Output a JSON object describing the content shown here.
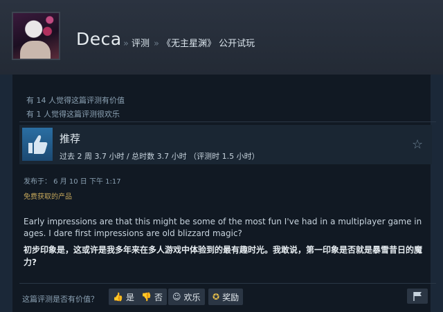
{
  "header": {
    "username": "Deca",
    "breadcrumbs": [
      "评测",
      "《无主星渊》 公开试玩"
    ],
    "separator": "»"
  },
  "helpful_stats": [
    "有 14 人觉得这篇评测有价值",
    "有 1 人觉得这篇评测很欢乐"
  ],
  "recommendation": {
    "title": "推荐",
    "hours": "过去 2 周 3.7 小时 / 总时数 3.7 小时 （评测时 1.5 小时）",
    "icon": "thumbs-up-icon"
  },
  "meta": {
    "posted": "发布于：  6 月 10 日 下午 1:17",
    "product_type": "免费获取的产品"
  },
  "review": {
    "text_en": "Early impressions are that this might be some of the most fun I've had in a multiplayer game in ages. I dare first impressions are old blizzard magic?",
    "text_zh": "初步印象是，这或许是我多年来在多人游戏中体验到的最有趣时光。我敢说，第一印象是否就是暴雪昔日的魔力?"
  },
  "feedback": {
    "question": "这篇评测是否有价值？",
    "buttons": [
      {
        "label": "是",
        "icon": "thumbs-up-icon"
      },
      {
        "label": "否",
        "icon": "thumbs-down-icon"
      },
      {
        "label": "欢乐",
        "icon": "smiley-icon"
      },
      {
        "label": "奖励",
        "icon": "award-icon"
      }
    ]
  },
  "colors": {
    "background": "#1b2838",
    "panel": "#111923",
    "accent_blue": "#2a6ea3",
    "free_label": "#c4a65a"
  }
}
